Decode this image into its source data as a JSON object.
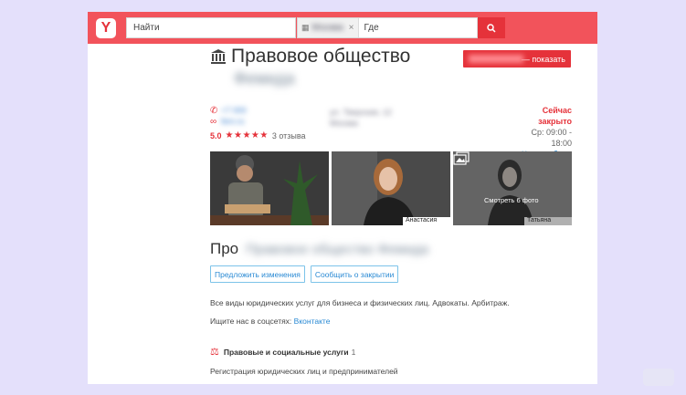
{
  "header": {
    "logo_letter": "Y",
    "search_placeholder": "Найти",
    "city_value": "Москва",
    "clear_icon": "×",
    "where_placeholder": "Где",
    "search_button_icon": "search-icon"
  },
  "business": {
    "title": "Правовое общество",
    "name_blurred": "Фемида",
    "show_phone_label": "— показать",
    "phone_blurred": "+7 000",
    "website_blurred": "fem.ru",
    "rating": "5.0",
    "stars": "★★★★★",
    "reviews": "3 отзыва",
    "address_blurred_line1": "ул. Тверская, 12",
    "address_blurred_line2": "Москва",
    "status_closed": "Сейчас закрыто",
    "hours": "Ср: 09:00 - 18:00",
    "hours_link": "Часы работы"
  },
  "photos": {
    "caption_2": "Анастасия",
    "caption_3": "Татьяна",
    "see_photos": "Смотреть 6 фото"
  },
  "about": {
    "heading": "Про",
    "name_blurred": "Правовое общество Фемида",
    "suggest_button": "Предложить изменения",
    "report_button": "Сообщить о закрытии",
    "description": "Все виды юридических услуг для бизнеса и физических лиц. Адвокаты. Арбитраж.",
    "social_label": "Ищите нас в соцсетях:",
    "social_link": "Вконтакте"
  },
  "category": {
    "name": "Правовые и социальные услуги",
    "count": "1",
    "service": "Регистрация юридических лиц и предпринимателей"
  },
  "colors": {
    "brand": "#e5323a",
    "topbar": "#f2535b",
    "link": "#2a8ad4",
    "background": "#e4e0fb"
  }
}
